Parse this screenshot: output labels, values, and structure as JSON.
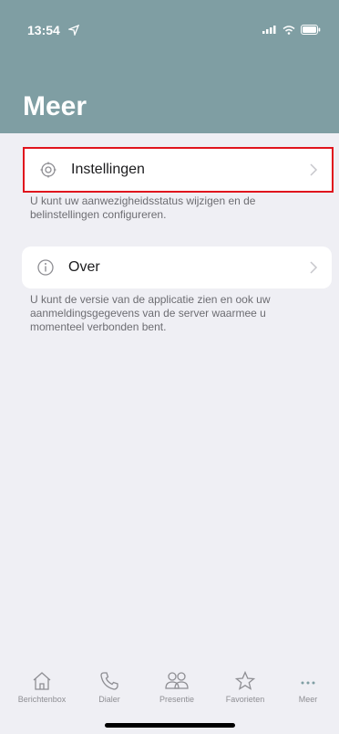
{
  "status_bar": {
    "time": "13:54"
  },
  "header": {
    "title": "Meer"
  },
  "items": [
    {
      "label": "Instellingen",
      "description": "U kunt uw aanwezigheidsstatus wijzigen en de belinstellingen configureren."
    },
    {
      "label": "Over",
      "description": "U kunt de versie van de applicatie zien en ook uw aanmeldingsgegevens van de server waarmee u momenteel verbonden bent."
    }
  ],
  "tabs": [
    {
      "label": "Berichtenbox",
      "icon": "home-icon"
    },
    {
      "label": "Dialer",
      "icon": "phone-icon"
    },
    {
      "label": "Presentie",
      "icon": "people-icon"
    },
    {
      "label": "Favorieten",
      "icon": "star-icon"
    },
    {
      "label": "Meer",
      "icon": "more-icon"
    }
  ],
  "colors": {
    "header": "#7f9ea3",
    "highlight": "#e0141d",
    "background": "#efeff4"
  }
}
